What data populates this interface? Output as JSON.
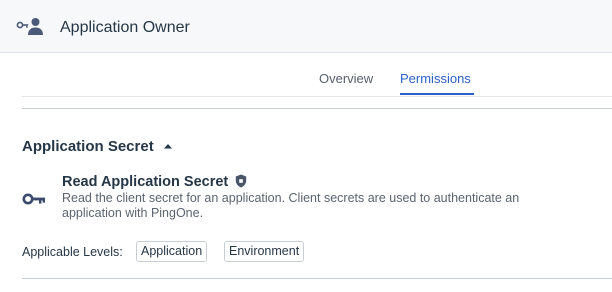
{
  "header": {
    "title": "Application Owner",
    "icon": "key-user-icon"
  },
  "tabs": [
    {
      "label": "Overview",
      "active": false
    },
    {
      "label": "Permissions",
      "active": true
    }
  ],
  "section": {
    "title": "Application Secret",
    "expanded": true,
    "permission": {
      "title": "Read Application Secret",
      "icon": "key-icon",
      "badge_icon": "shield-icon",
      "description": "Read the client secret for an application. Client secrets are used to authenticate an application with PingOne.",
      "levels_label": "Applicable Levels:",
      "levels": [
        "Application",
        "Environment"
      ]
    }
  },
  "colors": {
    "accent": "#2d60c6",
    "text": "#253746",
    "header_bg": "#f7f8fa"
  }
}
